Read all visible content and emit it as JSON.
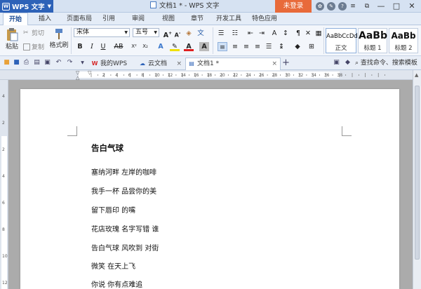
{
  "app": {
    "name": "WPS 文字",
    "window_title": "文档1 * - WPS 文字",
    "login_label": "未登录"
  },
  "window_controls": {
    "minimize": "—",
    "maximize": "□",
    "close": "✕"
  },
  "menu_tabs": [
    {
      "label": "开始",
      "active": true
    },
    {
      "label": "插入"
    },
    {
      "label": "页面布局"
    },
    {
      "label": "引用"
    },
    {
      "label": "审阅"
    },
    {
      "label": "视图"
    },
    {
      "label": "章节"
    },
    {
      "label": "开发工具"
    },
    {
      "label": "特色应用"
    }
  ],
  "ribbon": {
    "paste_label": "粘贴",
    "cut_label": "剪切",
    "copy_label": "复制",
    "format_painter_label": "格式刷",
    "font_name": "宋体",
    "font_size": "五号",
    "style_gallery": [
      {
        "sample": "AaBbCcDd",
        "name": "正文"
      },
      {
        "sample": "AaBb",
        "name": "标题 1"
      },
      {
        "sample": "AaBb",
        "name": "标题 2"
      }
    ]
  },
  "doc_tabs": [
    {
      "label": "我的WPS",
      "icon": "wps-icon"
    },
    {
      "label": "云文档",
      "icon": "cloud-icon"
    },
    {
      "label": "文档1 *",
      "icon": "doc-icon",
      "active": true
    }
  ],
  "search": {
    "label": "查找命令、搜索模板"
  },
  "document": {
    "title": "告白气球",
    "lines": [
      "塞纳河畔 左岸的咖啡",
      "我手一杯 品尝你的美",
      "留下唇印 的嘴",
      "花店玫瑰 名字写错 谁",
      "告白气球 风吹到 对街",
      "微笑 在天上飞",
      "你说 你有点难追"
    ]
  },
  "ruler": {
    "h_ticks": [
      "2",
      "4",
      "6",
      "8",
      "10",
      "12",
      "14",
      "16",
      "18",
      "20",
      "22",
      "24",
      "26",
      "28",
      "30",
      "32",
      "34",
      "36",
      "38"
    ],
    "v_ticks": [
      "4",
      "2",
      "2",
      "4",
      "6",
      "8",
      "10",
      "12"
    ]
  },
  "colors": {
    "accent": "#2d62b8",
    "login": "#e86a3a",
    "title_bar": "#d6e2f2"
  }
}
